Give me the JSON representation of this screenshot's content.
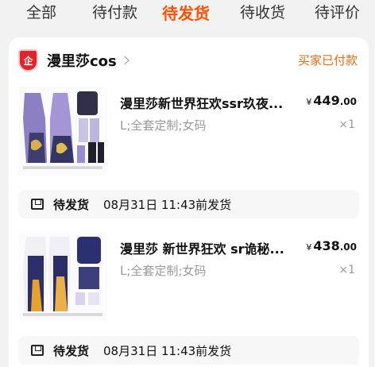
{
  "tabs": [
    "全部",
    "待付款",
    "待发货",
    "待收货",
    "待评价"
  ],
  "active_tab_color": "#ff5000",
  "shop": {
    "logo_text": "企",
    "name": "漫里莎cos",
    "order_status": "买家已付款"
  },
  "items": [
    {
      "title": "漫里莎新世界狂欢ssr玖夜...",
      "price_currency": "¥",
      "price_int": "449",
      "price_dec": ".00",
      "spec": "L;全套定制;女码",
      "quantity": "×1",
      "shipping": {
        "status": "待发货",
        "time": "08月31日 11:43前发货"
      }
    },
    {
      "title": "漫里莎 新世界狂欢 sr诡秘...",
      "price_currency": "¥",
      "price_int": "438",
      "price_dec": ".00",
      "spec": "L;全套定制;女码",
      "quantity": "×1",
      "shipping": {
        "status": "待发货",
        "time": "08月31日 11:43前发货"
      }
    }
  ]
}
